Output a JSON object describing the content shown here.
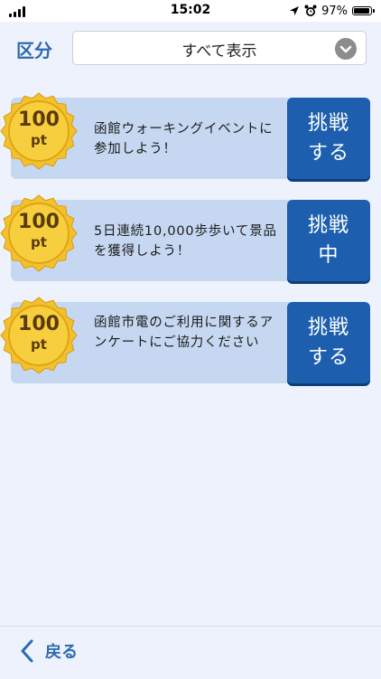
{
  "status_bar": {
    "time": "15:02",
    "battery_percent": "97%",
    "battery_level": 0.97
  },
  "filter": {
    "label": "区分",
    "selected": "すべて表示"
  },
  "challenges": [
    {
      "points": "100",
      "unit": "pt",
      "title": "函館ウォーキングイベントに参加しよう！",
      "button_line1": "挑戦",
      "button_line2": "する"
    },
    {
      "points": "100",
      "unit": "pt",
      "title": "5日連続10,000歩歩いて景品を獲得しよう！",
      "button_line1": "挑戦",
      "button_line2": "中"
    },
    {
      "points": "100",
      "unit": "pt",
      "title": "函館市電のご利用に関するアンケートにご協力ください",
      "button_line1": "挑戦",
      "button_line2": "する"
    }
  ],
  "footer": {
    "back_label": "戻る"
  },
  "colors": {
    "accent": "#2d6ab0",
    "button": "#1d5fae",
    "card": "#c6d8f1",
    "background": "#eef2fc",
    "medal": "#f2c12e"
  },
  "icons": [
    "signal-icon",
    "location-arrow-icon",
    "alarm-icon",
    "battery-icon",
    "chevron-down-icon",
    "medal-icon",
    "back-chevron-icon"
  ]
}
